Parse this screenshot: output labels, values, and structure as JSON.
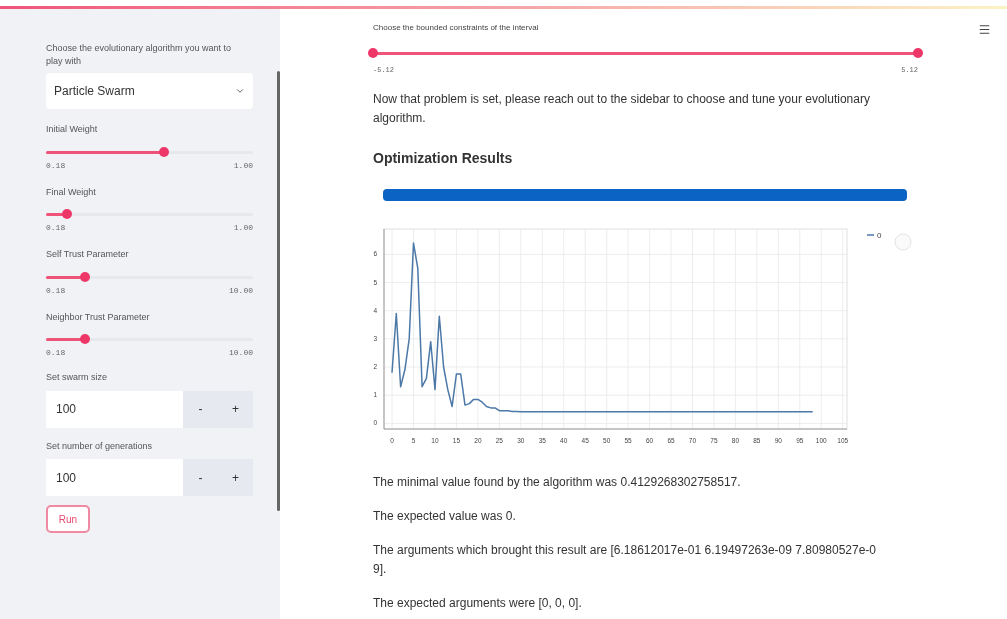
{
  "sidebar": {
    "algorithm_label": "Choose the evolutionary algorithm you want to play with",
    "algorithm_select": {
      "value": "Particle Swarm"
    },
    "sliders": [
      {
        "label": "Initial Weight",
        "level": 0.57,
        "min": "0.18",
        "max": "1.00"
      },
      {
        "label": "Final Weight",
        "level": 0.1,
        "min": "0.18",
        "max": "1.00"
      },
      {
        "label": "Self Trust Parameter",
        "level": 0.19,
        "min": "0.18",
        "max": "10.00"
      },
      {
        "label": "Neighbor Trust Parameter",
        "level": 0.19,
        "min": "0.18",
        "max": "10.00"
      }
    ],
    "number_inputs": [
      {
        "label": "Set swarm size",
        "value": "100",
        "minus": "-",
        "plus": "+"
      },
      {
        "label": "Set number of generations",
        "value": "100",
        "minus": "-",
        "plus": "+"
      }
    ],
    "run_button": "Run"
  },
  "main": {
    "interval_label": "Choose the bounded constraints of the interval",
    "interval_slider": {
      "handles": [
        {
          "level": 0
        },
        {
          "level": 1
        }
      ],
      "min": "-5.12",
      "max": "5.12"
    },
    "intro": "Now that problem is set, please reach out to the sidebar to choose and tune your evolutionary algorithm.",
    "heading": "Optimization Results",
    "progress": {
      "level": 1
    },
    "chart_data": {
      "type": "line",
      "x": [
        0,
        1,
        2,
        3,
        4,
        5,
        6,
        7,
        8,
        9,
        10,
        11,
        12,
        13,
        14,
        15,
        16,
        17,
        18,
        19,
        20,
        21,
        22,
        23,
        24,
        25,
        26,
        27,
        28,
        29,
        30,
        31,
        32,
        33,
        34,
        35,
        36,
        37,
        38,
        39,
        40,
        41,
        42,
        43,
        44,
        45,
        46,
        47,
        48,
        49,
        50,
        51,
        52,
        53,
        54,
        55,
        56,
        57,
        58,
        59,
        60,
        61,
        62,
        63,
        64,
        65,
        66,
        67,
        68,
        69,
        70,
        71,
        72,
        73,
        74,
        75,
        76,
        77,
        78,
        79,
        80,
        81,
        82,
        83,
        84,
        85,
        86,
        87,
        88,
        89,
        90,
        91,
        92,
        93,
        94,
        95,
        96,
        97,
        98
      ],
      "series": [
        {
          "name": "0",
          "color": "#4c78a8",
          "values": [
            1.8,
            3.9,
            1.3,
            1.9,
            3.0,
            6.4,
            5.5,
            1.3,
            1.6,
            2.9,
            1.2,
            3.8,
            2.0,
            1.2,
            0.6,
            1.75,
            1.75,
            0.65,
            0.7,
            0.85,
            0.85,
            0.75,
            0.6,
            0.55,
            0.55,
            0.45,
            0.45,
            0.45,
            0.42,
            0.42,
            0.41,
            0.41,
            0.41,
            0.41,
            0.41,
            0.41,
            0.41,
            0.41,
            0.41,
            0.41,
            0.41,
            0.41,
            0.41,
            0.41,
            0.41,
            0.41,
            0.41,
            0.41,
            0.41,
            0.41,
            0.41,
            0.41,
            0.41,
            0.41,
            0.41,
            0.41,
            0.41,
            0.41,
            0.41,
            0.41,
            0.41,
            0.41,
            0.41,
            0.41,
            0.41,
            0.41,
            0.41,
            0.41,
            0.41,
            0.41,
            0.41,
            0.41,
            0.41,
            0.41,
            0.41,
            0.41,
            0.41,
            0.41,
            0.41,
            0.41,
            0.41,
            0.41,
            0.41,
            0.41,
            0.41,
            0.41,
            0.41,
            0.41,
            0.41,
            0.41,
            0.41,
            0.41,
            0.41,
            0.41,
            0.41,
            0.41,
            0.41,
            0.41,
            0.41
          ]
        }
      ],
      "xlim": [
        -1.875,
        106
      ],
      "ylim": [
        -0.2,
        6.9
      ],
      "grid": true,
      "xticks": [
        0,
        5,
        10,
        15,
        20,
        25,
        30,
        35,
        40,
        45,
        50,
        55,
        60,
        65,
        70,
        75,
        80,
        85,
        90,
        95,
        100,
        105
      ],
      "yticks": [
        0,
        1,
        2,
        3,
        4,
        5,
        6
      ]
    },
    "results": [
      "The minimal value found by the algorithm was 0.4129268302758517.",
      "The expected value was 0.",
      "The arguments which brought this result are [6.18612017e-01 6.19497263e-09 7.80980527e-09].",
      "The expected arguments were [0, 0, 0]."
    ]
  }
}
